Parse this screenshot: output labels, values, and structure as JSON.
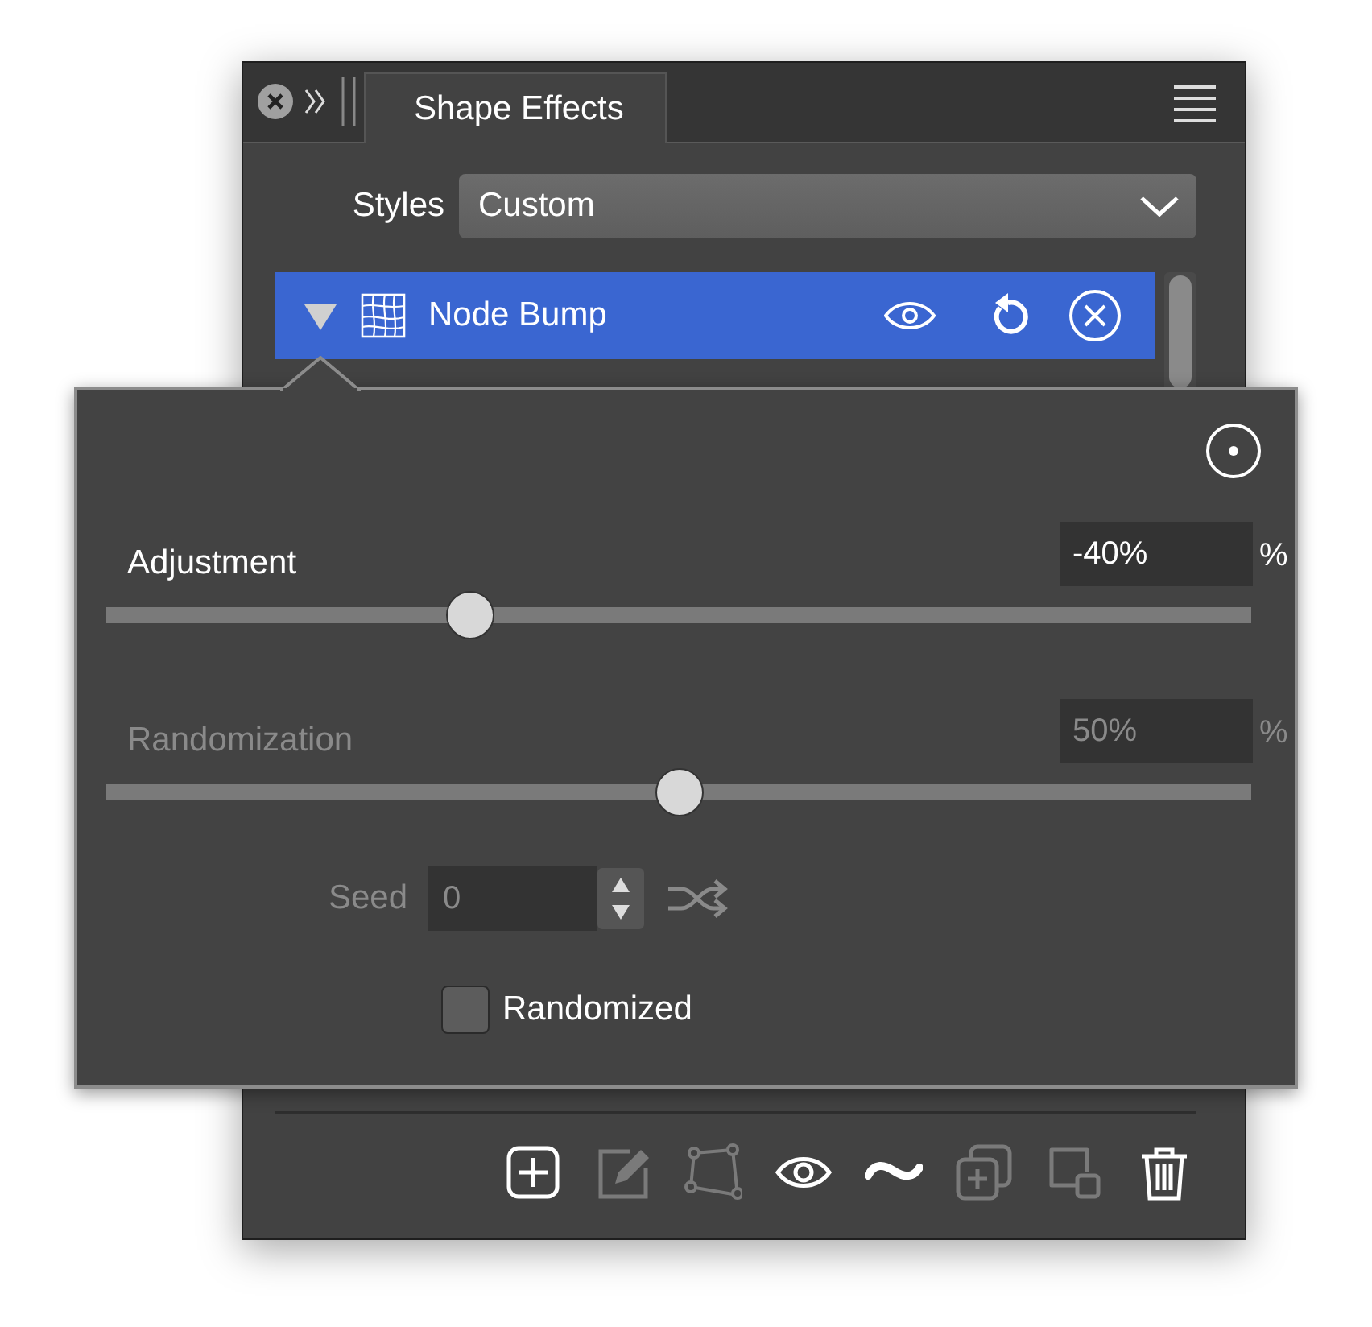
{
  "panel": {
    "tabs": [
      {
        "label": "Shape Effects",
        "selected": true
      }
    ],
    "styles": {
      "label": "Styles",
      "value": "Custom"
    },
    "effects": [
      {
        "name": "Node Bump",
        "selected": true,
        "expanded": true
      }
    ],
    "toolbar": [
      {
        "kind": "add",
        "disabled": false
      },
      {
        "kind": "edit",
        "disabled": true
      },
      {
        "kind": "nodes",
        "disabled": true
      },
      {
        "kind": "visibility",
        "disabled": false
      },
      {
        "kind": "curve",
        "disabled": false
      },
      {
        "kind": "duplicate",
        "disabled": true
      },
      {
        "kind": "overlap",
        "disabled": true
      },
      {
        "kind": "delete",
        "disabled": false
      }
    ]
  },
  "popover": {
    "sliders": [
      {
        "label": "Adjustment",
        "value": "-40%",
        "unit": "%",
        "level": 0.31,
        "disabled": false
      },
      {
        "label": "Randomization",
        "value": "50%",
        "unit": "%",
        "level": 0.5,
        "disabled": true
      }
    ],
    "seed": {
      "label": "Seed",
      "value": "0",
      "disabled": true
    },
    "randomized": {
      "label": "Randomized",
      "checked": false
    }
  }
}
